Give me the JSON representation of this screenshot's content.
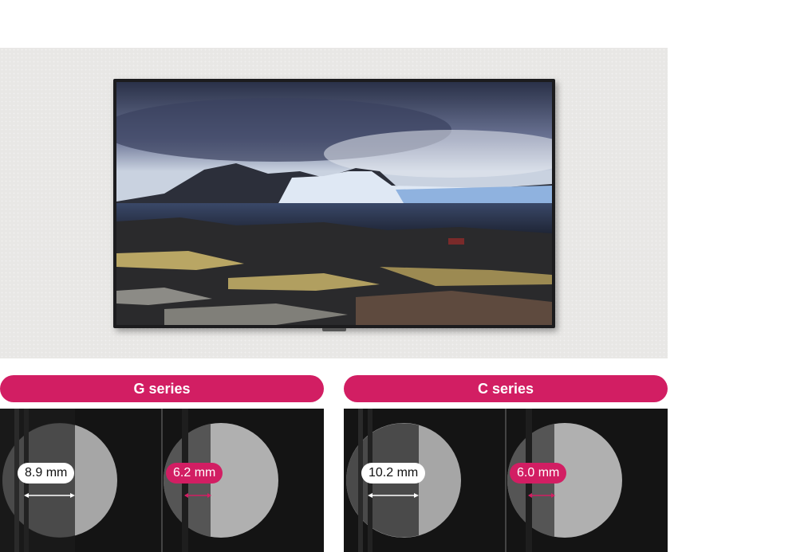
{
  "series": [
    {
      "name": "G series",
      "measurements": [
        "8.9 mm",
        "6.2 mm"
      ]
    },
    {
      "name": "C series",
      "measurements": [
        "10.2 mm",
        "6.0 mm"
      ]
    }
  ],
  "colors": {
    "accent": "#d21e63",
    "panel_bg": "#141414",
    "wall": "#e8e7e5"
  }
}
